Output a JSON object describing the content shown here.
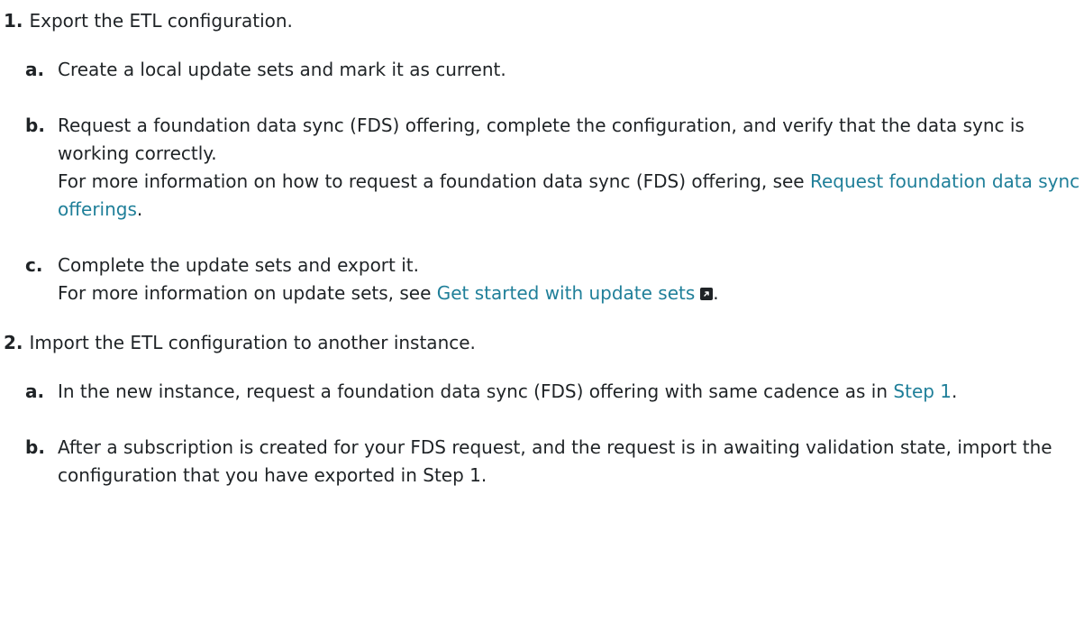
{
  "steps": [
    {
      "number": "1.",
      "text": "Export the ETL configuration.",
      "substeps": [
        {
          "letter": "a.",
          "text": "Create a local update sets and mark it as current."
        },
        {
          "letter": "b.",
          "text": "Request a foundation data sync (FDS) offering, complete the configuration, and verify that the data sync is working correctly.",
          "more_prefix": "For more information on how to request a foundation data sync (FDS) offering, see ",
          "link_text": "Request foundation data sync offerings",
          "suffix": "."
        },
        {
          "letter": "c.",
          "text": "Complete the update sets and export it.",
          "more_prefix": "For more information on update sets, see ",
          "link_text": "Get started with update sets",
          "suffix": "."
        }
      ]
    },
    {
      "number": "2.",
      "text": "Import the ETL configuration to another instance.",
      "substeps": [
        {
          "letter": "a.",
          "text": "In the new instance, request a foundation data sync (FDS) offering with same cadence as in ",
          "link_text": "Step 1",
          "suffix": "."
        },
        {
          "letter": "b.",
          "text": "After a subscription is created for your FDS request, and the request is in awaiting validation state, import the configuration that you have exported in Step 1."
        }
      ]
    }
  ],
  "icons": {
    "external_link": "external-link-icon"
  },
  "colors": {
    "text": "#1f2326",
    "link": "#1f7f99"
  }
}
